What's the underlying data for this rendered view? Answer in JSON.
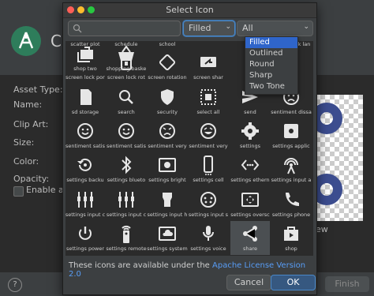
{
  "background": {
    "title": "C",
    "labels": [
      "Asset Type:",
      "Name:",
      "Clip Art:",
      "Size:",
      "Color:",
      "Opacity:"
    ],
    "checkbox_label": "Enable au",
    "preview_label": "ew",
    "help": "?",
    "finish_label": "Finish"
  },
  "dialog": {
    "title": "Select Icon",
    "search_placeholder": "",
    "style_dropdown": "Filled",
    "category_dropdown": "All",
    "style_options": [
      "Filled",
      "Outlined",
      "Round",
      "Sharp",
      "Two Tone"
    ],
    "license_text": "These icons are available under the",
    "license_link": "Apache License Version 2.0",
    "cancel_label": "Cancel",
    "ok_label": "OK"
  },
  "icons": [
    {
      "label": "scatter plot",
      "icon": "scatter-plot-icon"
    },
    {
      "label": "schedule",
      "icon": "schedule-icon"
    },
    {
      "label": "school",
      "icon": "school-icon"
    },
    {
      "label": "",
      "icon": ""
    },
    {
      "label": "",
      "icon": ""
    },
    {
      "label": "screen lock lan",
      "icon": "screen-lock-landscape-icon"
    },
    {
      "label": "screen lock por",
      "icon": "screen-lock-portrait-icon"
    },
    {
      "label": "screen lock rot",
      "icon": "screen-lock-rotation-icon"
    },
    {
      "label": "screen rotation",
      "icon": "screen-rotation-icon"
    },
    {
      "label": "screen shar",
      "icon": "screen-share-icon"
    },
    {
      "label": "",
      "icon": ""
    },
    {
      "label": "",
      "icon": ""
    },
    {
      "label": "sd storage",
      "icon": "sd-storage-icon"
    },
    {
      "label": "search",
      "icon": "search-icon"
    },
    {
      "label": "security",
      "icon": "security-icon"
    },
    {
      "label": "select all",
      "icon": "select-all-icon"
    },
    {
      "label": "send",
      "icon": "send-icon"
    },
    {
      "label": "sentiment dissa",
      "icon": "sentiment-dissatisfied-icon"
    },
    {
      "label": "sentiment satis",
      "icon": "sentiment-satisfied-icon"
    },
    {
      "label": "sentiment satis",
      "icon": "sentiment-satisfied-alt-icon"
    },
    {
      "label": "sentiment very",
      "icon": "sentiment-very-dissatisfied-icon"
    },
    {
      "label": "sentiment very",
      "icon": "sentiment-very-satisfied-icon"
    },
    {
      "label": "settings",
      "icon": "settings-icon"
    },
    {
      "label": "settings applic",
      "icon": "settings-applications-icon"
    },
    {
      "label": "settings backu",
      "icon": "settings-backup-restore-icon"
    },
    {
      "label": "settings blueto",
      "icon": "settings-bluetooth-icon"
    },
    {
      "label": "settings bright",
      "icon": "settings-brightness-icon"
    },
    {
      "label": "settings cell",
      "icon": "settings-cell-icon"
    },
    {
      "label": "settings ethern",
      "icon": "settings-ethernet-icon"
    },
    {
      "label": "settings input a",
      "icon": "settings-input-antenna-icon"
    },
    {
      "label": "settings input c",
      "icon": "settings-input-component-icon"
    },
    {
      "label": "settings input c",
      "icon": "settings-input-composite-icon"
    },
    {
      "label": "settings input h",
      "icon": "settings-input-hdmi-icon"
    },
    {
      "label": "settings input s",
      "icon": "settings-input-svideo-icon"
    },
    {
      "label": "settings oversc",
      "icon": "settings-overscan-icon"
    },
    {
      "label": "settings phone",
      "icon": "settings-phone-icon"
    },
    {
      "label": "settings power",
      "icon": "settings-power-icon"
    },
    {
      "label": "settings remote",
      "icon": "settings-remote-icon"
    },
    {
      "label": "settings system",
      "icon": "settings-system-daydream-icon"
    },
    {
      "label": "settings voice",
      "icon": "settings-voice-icon"
    },
    {
      "label": "share",
      "icon": "share-icon"
    },
    {
      "label": "shop",
      "icon": "shop-icon"
    },
    {
      "label": "shop two",
      "icon": "shop-two-icon"
    },
    {
      "label": "shopping baske",
      "icon": "shopping-basket-icon"
    }
  ],
  "selected_icon": "share",
  "colors": {
    "accent": "#4a88c7",
    "link": "#589df6",
    "menu_selection": "#2f65ca",
    "ok_button": "#365880",
    "preview_icon": "#3c4d8f"
  }
}
